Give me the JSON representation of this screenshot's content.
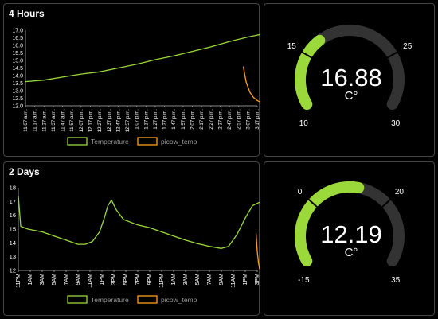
{
  "panels": {
    "p4h": {
      "title": "4 Hours"
    },
    "p2d": {
      "title": "2 Days"
    }
  },
  "colors": {
    "temperature": "#9bd83a",
    "picow": "#ff9f1a",
    "gauge_bg": "#333333",
    "panel_border": "#444444"
  },
  "chart_data": [
    {
      "type": "line",
      "title": "4 Hours",
      "xlabel": "",
      "ylabel": "",
      "ylim": [
        12.0,
        17.0
      ],
      "y_ticks": [
        "17.0",
        "16.5",
        "16.0",
        "15.5",
        "15.0",
        "14.5",
        "14.0",
        "13.5",
        "13.0",
        "12.5",
        "12.0"
      ],
      "x_ticks": [
        "11:07 a.m.",
        "11:17 a.m.",
        "11:27 a.m.",
        "11:37 a.m.",
        "11:47 a.m.",
        "11:57 a.m.",
        "12:07 p.m.",
        "12:17 p.m.",
        "12:27 p.m.",
        "12:37 p.m.",
        "12:47 p.m.",
        "12:57 p.m.",
        "1:07 p.m.",
        "1:17 p.m.",
        "1:27 p.m.",
        "1:37 p.m.",
        "1:47 p.m.",
        "1:57 p.m.",
        "2:07 p.m.",
        "2:17 p.m.",
        "2:27 p.m.",
        "2:37 p.m.",
        "2:47 p.m.",
        "2:57 p.m.",
        "3:07 p.m.",
        "3:17 p.m."
      ],
      "legend_position": "bottom",
      "series": [
        {
          "name": "Temperature",
          "color": "#9bd83a",
          "x": [
            0,
            2,
            4,
            6,
            8,
            10,
            12,
            14,
            16,
            18,
            20,
            22,
            24,
            26
          ],
          "y": [
            13.6,
            13.7,
            13.9,
            14.1,
            14.25,
            14.5,
            14.75,
            15.05,
            15.3,
            15.6,
            15.9,
            16.25,
            16.55,
            16.8
          ]
        },
        {
          "name": "picow_temp",
          "color": "#ff9f1a",
          "x": [
            23.5,
            23.8,
            24.2,
            24.6,
            25.0,
            25.5,
            25.9
          ],
          "y": [
            14.6,
            13.6,
            12.9,
            12.55,
            12.35,
            12.2,
            12.2
          ]
        }
      ]
    },
    {
      "type": "line",
      "title": "2 Days",
      "xlabel": "",
      "ylabel": "",
      "ylim": [
        12,
        18
      ],
      "y_ticks": [
        "18",
        "17",
        "16",
        "15",
        "14",
        "13",
        "12"
      ],
      "x_ticks": [
        "11PM",
        "1AM",
        "3AM",
        "5AM",
        "7AM",
        "9AM",
        "11AM",
        "1PM",
        "3PM",
        "5PM",
        "7PM",
        "9PM",
        "11PM",
        "1AM",
        "3AM",
        "5AM",
        "7AM",
        "9AM",
        "11AM",
        "1PM",
        "3PM"
      ],
      "legend_position": "bottom",
      "series": [
        {
          "name": "Temperature",
          "color": "#9bd83a",
          "x": [
            0,
            0.2,
            0.8,
            2,
            3,
            4,
            5,
            5.6,
            6.2,
            6.8,
            7.2,
            7.5,
            7.8,
            8.2,
            8.8,
            10,
            11,
            12,
            13,
            14,
            15,
            16,
            17,
            17.6,
            18.3,
            19,
            19.6,
            20.2
          ],
          "y": [
            17.4,
            15.2,
            15.0,
            14.8,
            14.5,
            14.2,
            13.9,
            13.9,
            14.1,
            14.8,
            15.8,
            16.7,
            17.1,
            16.4,
            15.7,
            15.3,
            15.1,
            14.8,
            14.5,
            14.2,
            13.95,
            13.75,
            13.6,
            13.75,
            14.6,
            15.8,
            16.7,
            16.95
          ]
        },
        {
          "name": "picow_temp",
          "color": "#ff9f1a",
          "x": [
            19.9,
            20.0,
            20.1,
            20.2
          ],
          "y": [
            14.7,
            13.4,
            12.6,
            12.1
          ]
        }
      ]
    }
  ],
  "gauges": {
    "g1": {
      "value": "16.88",
      "unit": "C°",
      "min": 10,
      "max": 30,
      "min_label": "10",
      "max_label": "30",
      "low_label": "15",
      "high_label": "25",
      "low_threshold": 15,
      "high_threshold": 25
    },
    "g2": {
      "value": "12.19",
      "unit": "C°",
      "min": -15,
      "max": 35,
      "min_label": "-15",
      "max_label": "35",
      "low_label": "0",
      "high_label": "20",
      "low_threshold": 0,
      "high_threshold": 20
    }
  }
}
